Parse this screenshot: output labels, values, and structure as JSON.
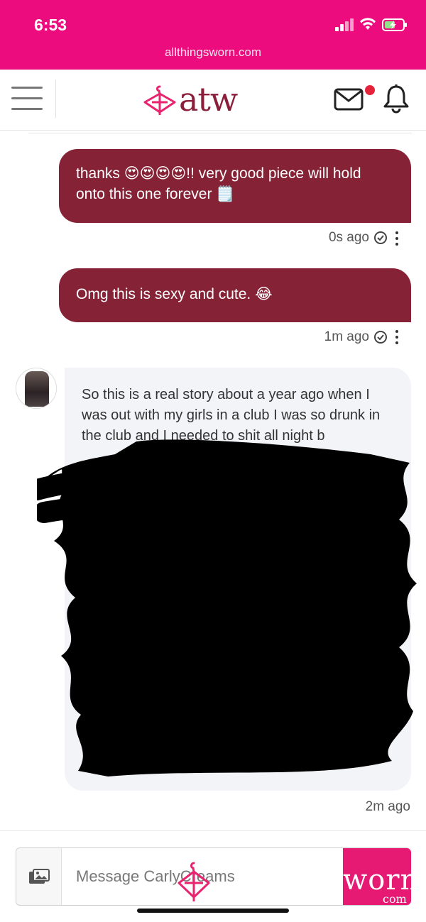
{
  "status_bar": {
    "time": "6:53",
    "colors": {
      "bar": "#ec0c7d"
    }
  },
  "browser": {
    "url": "allthingsworn.com"
  },
  "header": {
    "logo_text": "atw",
    "brand_color": "#8b1f3b",
    "icons": [
      "menu-icon",
      "mail-icon",
      "bell-icon"
    ]
  },
  "messages": [
    {
      "text": "thanks 😍😍😍😍!! very good piece will hold onto this one forever 🗒️",
      "time": "0s ago"
    },
    {
      "text": "Omg this is sexy and cute. 😂",
      "time": "1m ago"
    },
    {
      "text": "So this is a real story about a year ago when I was out with my girls in a club I was so drunk in the club and I needed to shit all night b",
      "time": "2m ago"
    }
  ],
  "redaction_emoji": "😍",
  "composer": {
    "placeholder": "Message CarlyCreams",
    "watermark": "worn",
    "watermark_sub": "com"
  }
}
